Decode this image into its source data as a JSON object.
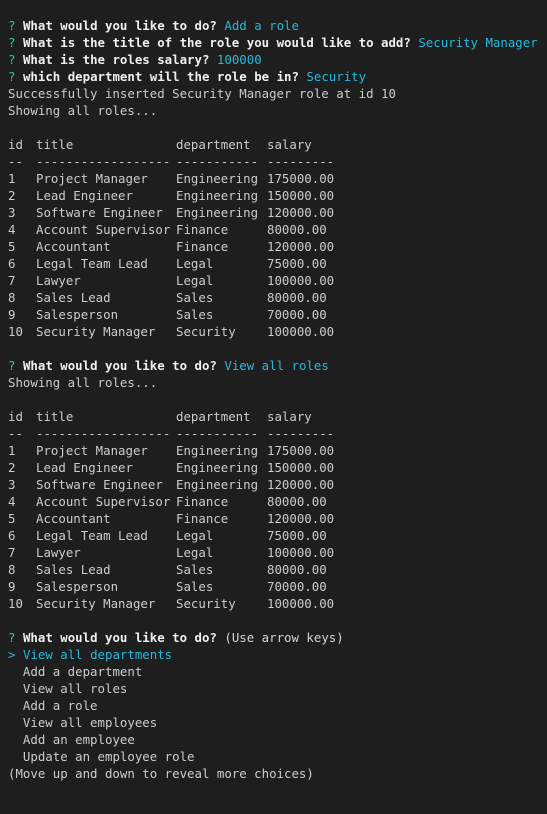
{
  "colors": {
    "background": "#1e1e1e",
    "text": "#cccccc",
    "prompt_mark": "#23d18b",
    "answer": "#29b8db"
  },
  "prompts": {
    "p1": {
      "mark": "?",
      "question": "What would you like to do?",
      "answer": "Add a role"
    },
    "p2": {
      "mark": "?",
      "question": "What is the title of the role you would like to add?",
      "answer": "Security Manager"
    },
    "p3": {
      "mark": "?",
      "question": "What is the roles salary?",
      "answer": "100000"
    },
    "p4": {
      "mark": "?",
      "question": "which department will the role be in?",
      "answer": "Security"
    },
    "p5": {
      "mark": "?",
      "question": "What would you like to do?",
      "answer": "View all roles"
    },
    "p6": {
      "mark": "?",
      "question": "What would you like to do?",
      "hint": "(Use arrow keys)"
    }
  },
  "messages": {
    "inserted": "Successfully inserted Security Manager role at id 10",
    "showing1": "Showing all roles...",
    "showing2": "Showing all roles..."
  },
  "table": {
    "headers": [
      "id",
      "title",
      "department",
      "salary"
    ],
    "separators": [
      "--",
      "------------------",
      "-----------",
      "---------"
    ],
    "rows": [
      [
        "1",
        "Project Manager",
        "Engineering",
        "175000.00"
      ],
      [
        "2",
        "Lead Engineer",
        "Engineering",
        "150000.00"
      ],
      [
        "3",
        "Software Engineer",
        "Engineering",
        "120000.00"
      ],
      [
        "4",
        "Account Supervisor",
        "Finance",
        "80000.00"
      ],
      [
        "5",
        "Accountant",
        "Finance",
        "120000.00"
      ],
      [
        "6",
        "Legal Team Lead",
        "Legal",
        "75000.00"
      ],
      [
        "7",
        "Lawyer",
        "Legal",
        "100000.00"
      ],
      [
        "8",
        "Sales Lead",
        "Sales",
        "80000.00"
      ],
      [
        "9",
        "Salesperson",
        "Sales",
        "70000.00"
      ],
      [
        "10",
        "Security Manager",
        "Security",
        "100000.00"
      ]
    ]
  },
  "menu": {
    "pointer": ">",
    "items": [
      "View all departments",
      "Add a department",
      "View all roles",
      "Add a role",
      "View all employees",
      "Add an employee",
      "Update an employee role"
    ],
    "footer": "(Move up and down to reveal more choices)"
  }
}
